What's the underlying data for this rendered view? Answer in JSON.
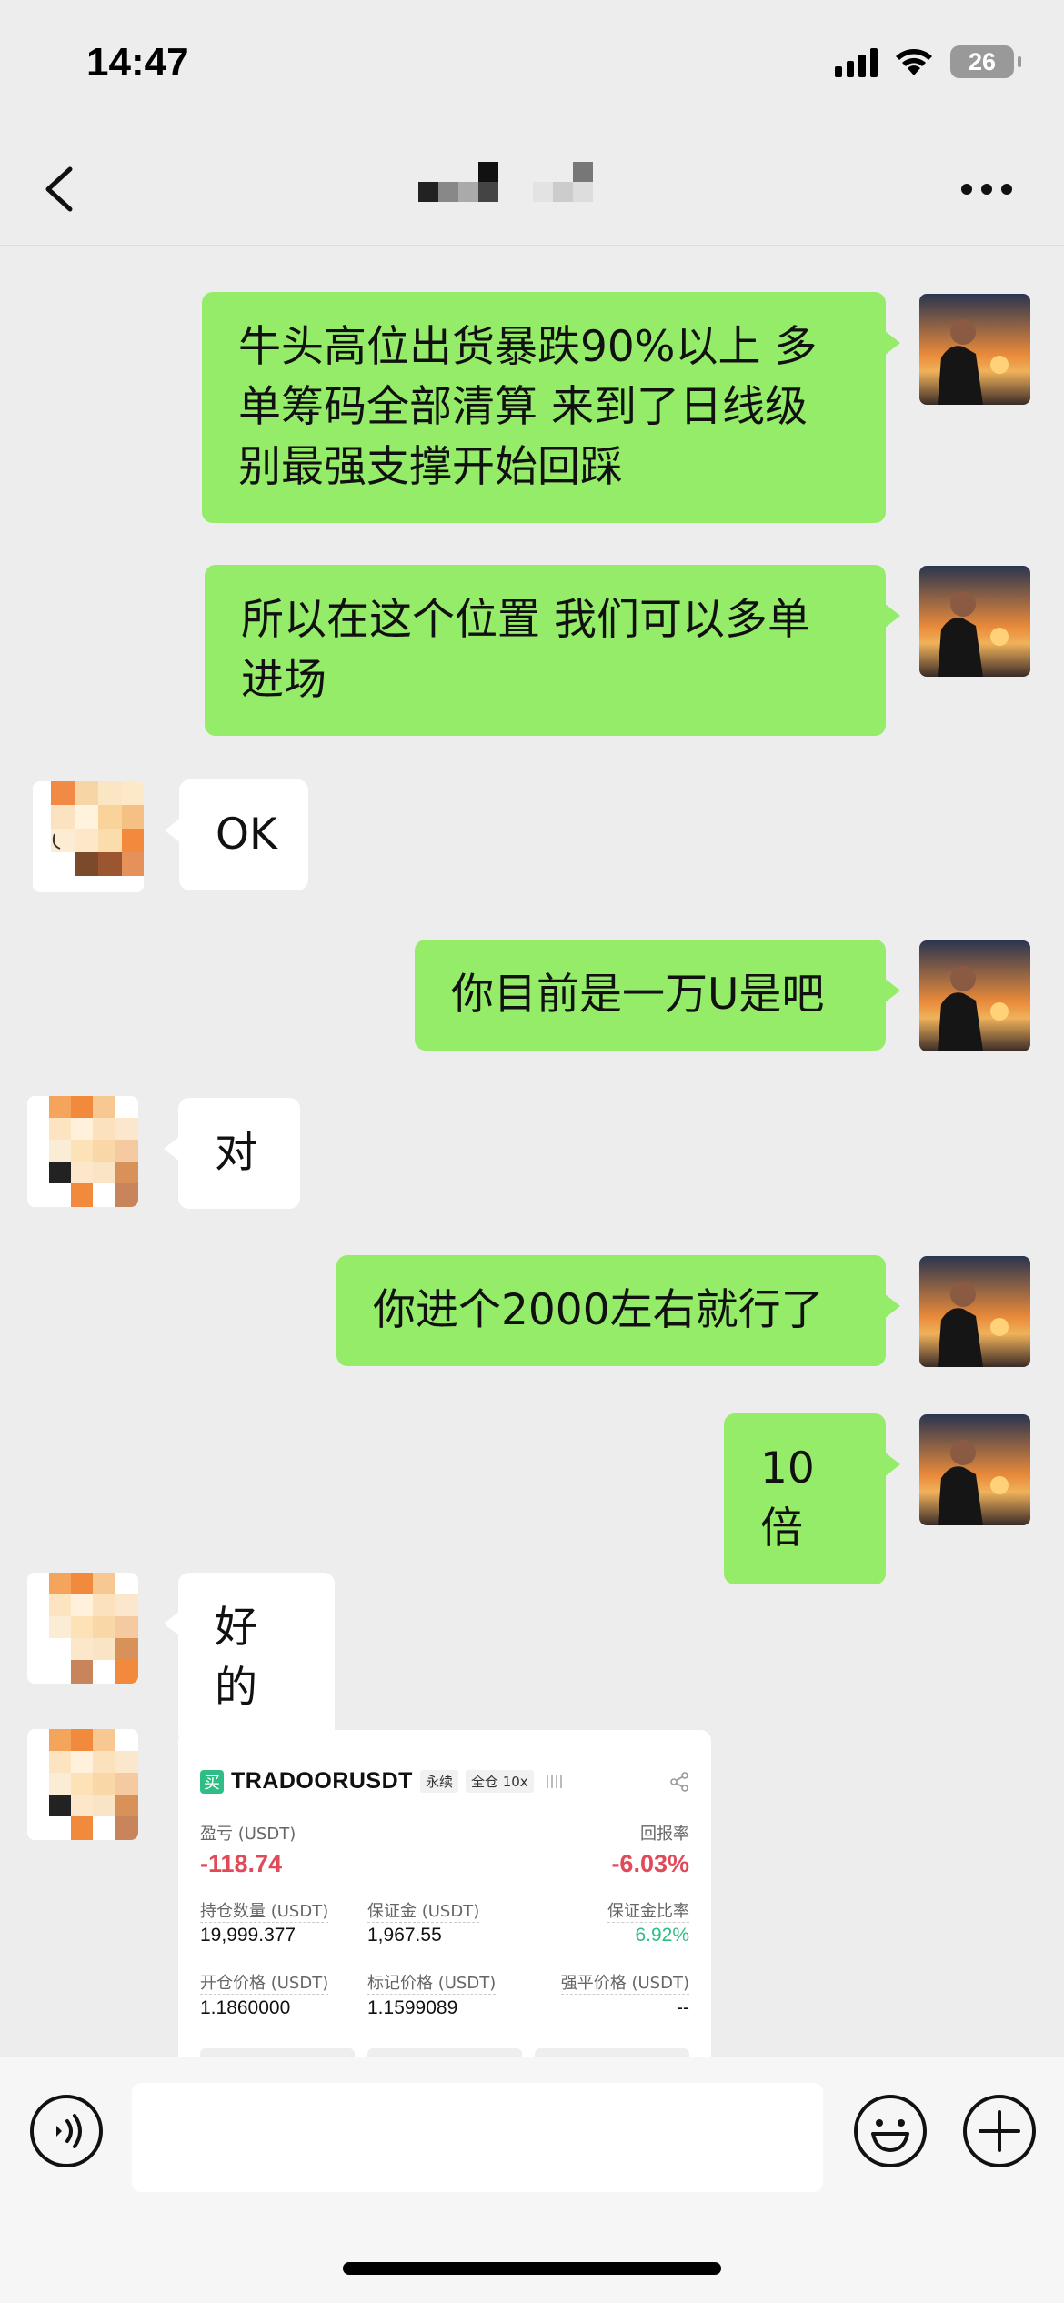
{
  "status_bar": {
    "time": "14:47",
    "battery": "26"
  },
  "nav": {
    "title": ""
  },
  "messages": [
    {
      "side": "me",
      "text": "牛头高位出货暴跌90%以上 多\n单筹码全部清算 来到了日线级\n别最强支撑开始回踩"
    },
    {
      "side": "me",
      "text": "所以在这个位置 我们可以多单\n进场"
    },
    {
      "side": "other",
      "text": "OK"
    },
    {
      "side": "me",
      "text": "你目前是一万U是吧"
    },
    {
      "side": "other",
      "text": "对"
    },
    {
      "side": "me",
      "text": "你进个2000左右就行了"
    },
    {
      "side": "me",
      "text": "10倍"
    },
    {
      "side": "other",
      "text": "好的"
    }
  ],
  "trade_card": {
    "buy_tag": "买",
    "pair": "TRADOORUSDT",
    "contract_type": "永续",
    "margin_mode": "全仓 10x",
    "pnl_label": "盈亏 (USDT)",
    "pnl_value": "-118.74",
    "roe_label": "回报率",
    "roe_value": "-6.03%",
    "position_label": "持仓数量 (USDT)",
    "position_value": "19,999.377",
    "margin_label": "保证金 (USDT)",
    "margin_value": "1,967.55",
    "margin_ratio_label": "保证金比率",
    "margin_ratio_value": "6.92%",
    "entry_label": "开仓价格 (USDT)",
    "entry_value": "1.1860000",
    "mark_label": "标记价格 (USDT)",
    "mark_value": "1.1599089",
    "liq_label": "强平价格 (USDT)",
    "liq_value": "--"
  },
  "input": {
    "placeholder": ""
  },
  "colors": {
    "my_bubble": "#95ec69",
    "other_bubble": "#ffffff",
    "background": "#ededed",
    "loss_red": "#e04a59",
    "gain_green": "#2ebd85"
  }
}
